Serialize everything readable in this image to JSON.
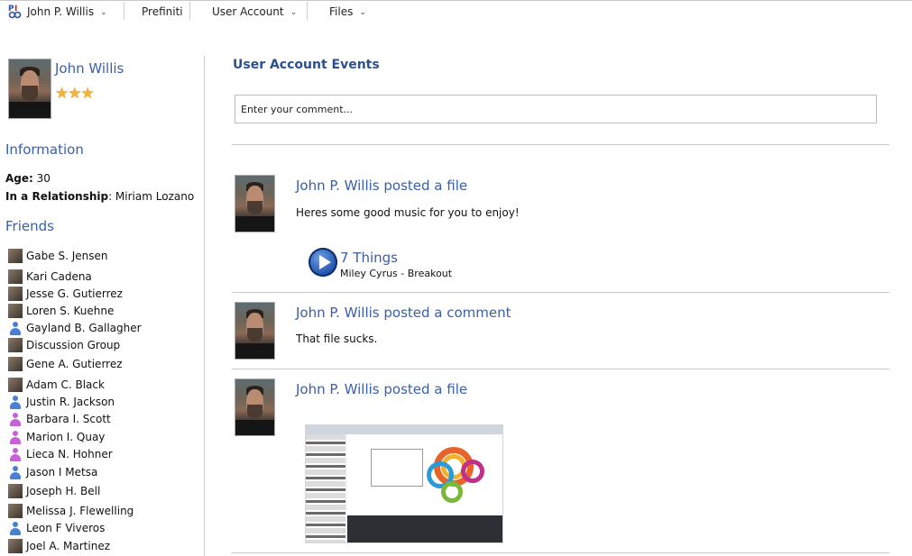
{
  "nav": {
    "user": "John P. Willis",
    "prefiniti": "Prefiniti",
    "user_account": "User Account",
    "files": "Files"
  },
  "profile": {
    "name": "John Willis",
    "stars": "★★★",
    "rating": 3,
    "information_title": "Information",
    "age_label": "Age:",
    "age_value": "30",
    "relationship_label": "In a Relationship",
    "relationship_value": ": Miriam Lozano",
    "friends_title": "Friends",
    "friends": [
      {
        "name": "Gabe S. Jensen",
        "icon": "photo"
      },
      {
        "name": "Kari Cadena",
        "icon": "photo"
      },
      {
        "name": "Jesse G. Gutierrez",
        "icon": "photo"
      },
      {
        "name": "Loren S. Kuehne",
        "icon": "photo"
      },
      {
        "name": "Gayland B. Gallagher",
        "icon": "person-blue"
      },
      {
        "name": "Discussion Group",
        "icon": "photo"
      },
      {
        "name": "Gene A. Gutierrez",
        "icon": "photo"
      },
      {
        "name": "Adam C. Black",
        "icon": "photo"
      },
      {
        "name": "Justin R. Jackson",
        "icon": "person-blue"
      },
      {
        "name": "Barbara I. Scott",
        "icon": "person-pink"
      },
      {
        "name": "Marion I. Quay",
        "icon": "person-pink"
      },
      {
        "name": "Lieca N. Hohner",
        "icon": "person-pink"
      },
      {
        "name": "Jason I Metsa",
        "icon": "person-blue"
      },
      {
        "name": "Joseph H. Bell",
        "icon": "photo"
      },
      {
        "name": "Melissa J. Flewelling",
        "icon": "photo"
      },
      {
        "name": "Leon F Viveros",
        "icon": "person-blue"
      },
      {
        "name": "Joel A. Martinez",
        "icon": "photo"
      }
    ]
  },
  "main": {
    "title": "User Account Events",
    "comment_placeholder": "Enter your comment...",
    "events": [
      {
        "title": "John P. Willis posted a file",
        "body": "Heres some good music for you to enjoy!",
        "track_title": "7 Things",
        "track_sub": "Miley Cyrus - Breakout"
      },
      {
        "title": "John P. Willis posted a comment",
        "body": "That file sucks."
      },
      {
        "title": "John P. Willis posted a file"
      }
    ]
  },
  "colors": {
    "link_blue": "#3a5fa8",
    "title_blue": "#2c4f8f",
    "star_gold": "#f2b53a"
  }
}
